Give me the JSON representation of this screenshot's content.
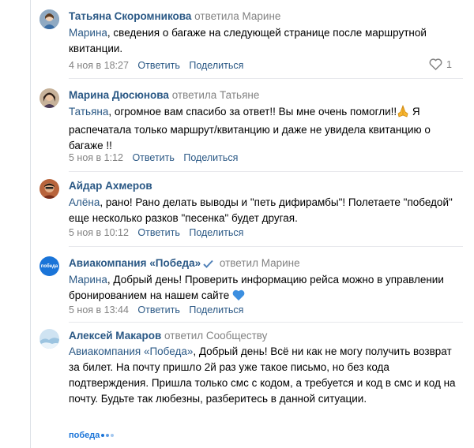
{
  "comments": [
    {
      "author": "Татьяна Скоромникова",
      "reply_to": "ответила Марине",
      "mention": "Марина",
      "text": ", сведения о багаже на следующей странице после маршрутной квитанции.",
      "date": "4 ноя в 18:27",
      "reply_label": "Ответить",
      "share_label": "Поделиться",
      "likes": "1",
      "avatar_icon": "user-avatar-photo"
    },
    {
      "author": "Марина Дюсюнова",
      "reply_to": "ответила Татьяне",
      "mention": "Татьяна",
      "text": ", огромное вам спасибо за ответ!! Вы мне очень помогли!!",
      "text2": " Я распечатала только маршрут/квитанцию и даже не увидела квитанцию о багаже !!",
      "emoji": "folded-hands-emoji",
      "date": "5 ноя в 1:12",
      "reply_label": "Ответить",
      "share_label": "Поделиться",
      "avatar_icon": "user-avatar-photo"
    },
    {
      "author": "Айдар Ахмеров",
      "reply_to": "",
      "mention": "Алёна",
      "text": ", рано! Рано делать выводы и \"петь дифирамбы\"! Полетаете \"победой\" еще несколько разков \"песенка\" будет другая.",
      "date": "5 ноя в 10:12",
      "reply_label": "Ответить",
      "share_label": "Поделиться",
      "avatar_icon": "user-avatar-photo"
    },
    {
      "author": "Авиакомпания «Победа»",
      "reply_to": "ответил Марине",
      "mention": "Марина",
      "text": ", Добрый день! Проверить информацию рейса можно в управлении бронированием на нашем сайте",
      "emoji": "blue-heart-emoji",
      "date": "5 ноя в 13:44",
      "reply_label": "Ответить",
      "share_label": "Поделиться",
      "avatar_icon": "pobeda-logo-avatar",
      "avatar_text": "победа"
    },
    {
      "author": "Алексей Макаров",
      "reply_to": "ответил Сообществу",
      "mention": "Авиакомпания «Победа»",
      "text": ", Добрый день! Всё ни как не могу получить возврат за билет. На почту пришло 2й раз уже такое письмо, но без кода подтверждения. Пришла только смс с кодом, а требуется и код в смс и код на почту. Будьте так любезны, разберитесь в данной ситуации.",
      "avatar_icon": "user-avatar-photo"
    }
  ],
  "footer_logo": "победа",
  "colors": {
    "link": "#2a5885",
    "muted": "#828282",
    "brand": "#1a74d8",
    "heart": "#3c8fe0"
  }
}
